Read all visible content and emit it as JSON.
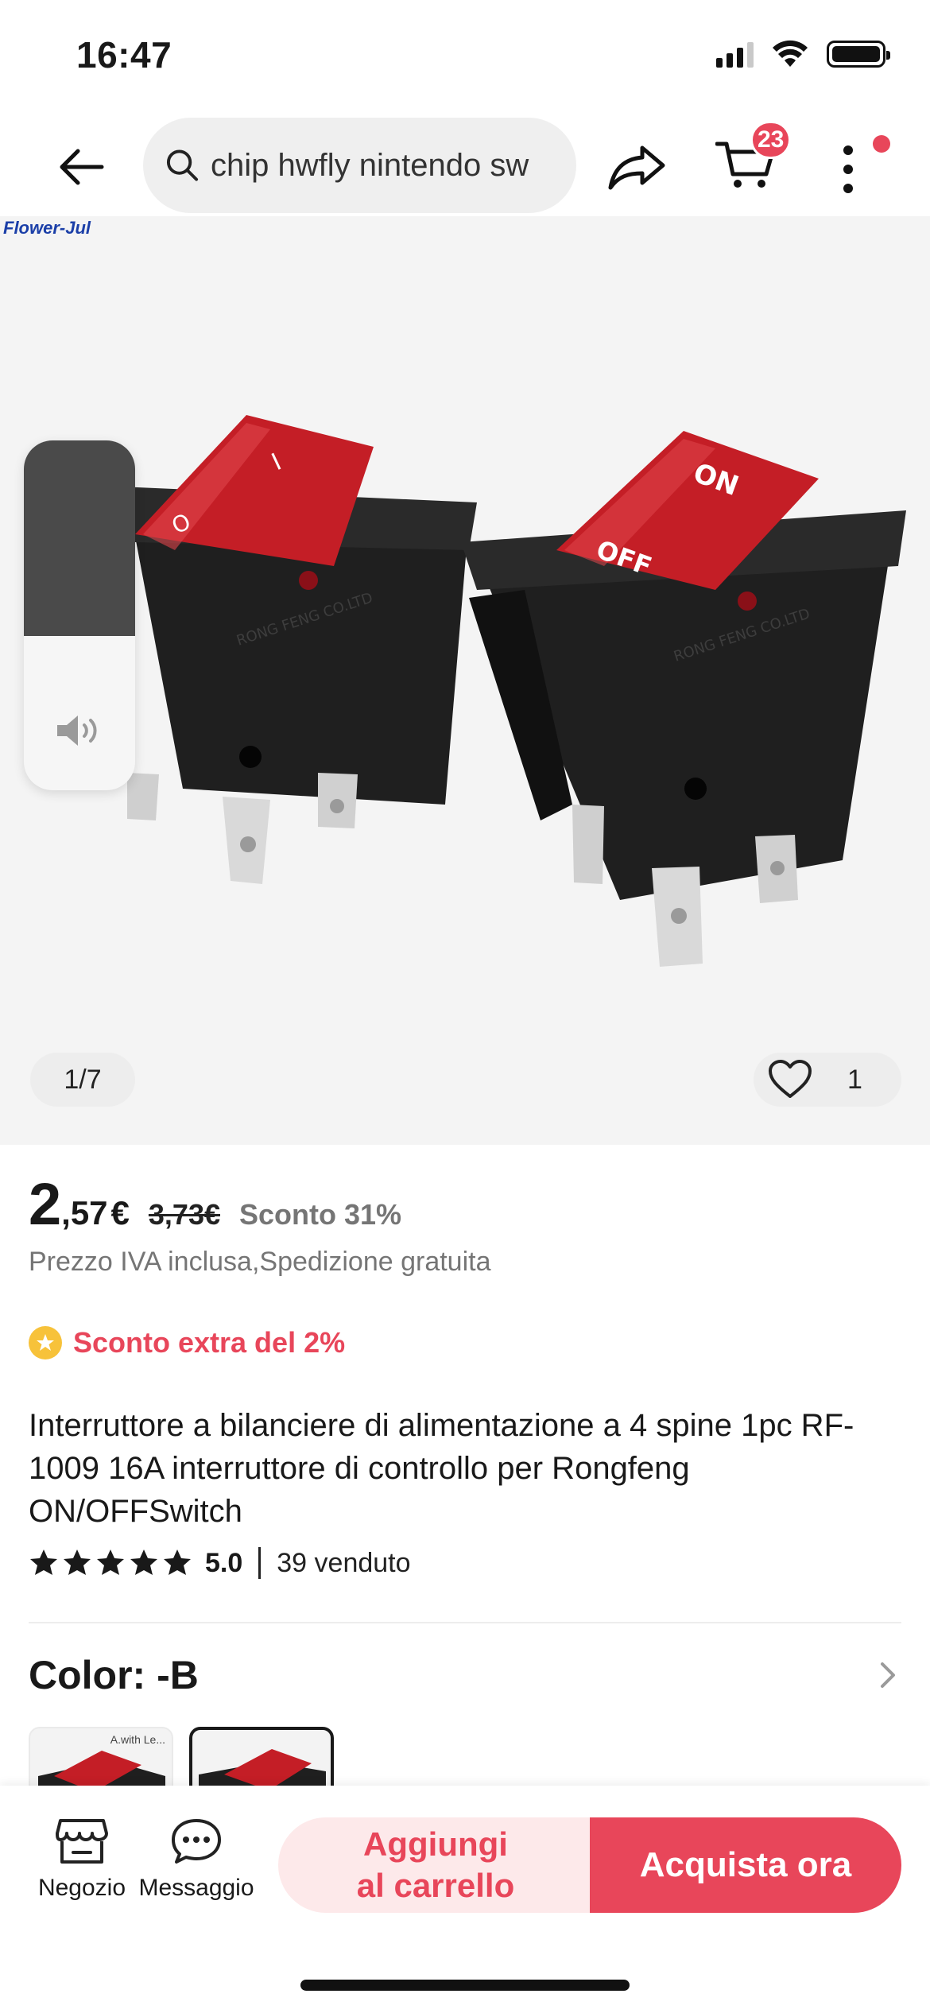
{
  "status_bar": {
    "time": "16:47"
  },
  "header": {
    "search_value": "chip hwfly nintendo sw",
    "cart_count": "23"
  },
  "gallery": {
    "watermark": "Flower-Jul",
    "page_indicator": "1/7",
    "wishlist_count": "1",
    "volume_level": 0.56,
    "switch_labels": {
      "on": "ON",
      "off": "OFF",
      "one": "I",
      "zero": "O"
    },
    "switch_body_text": "RONG FENG CO.LTD"
  },
  "price": {
    "integer": "2",
    "decimal": ",57",
    "currency": "€",
    "original": "3,73€",
    "discount": "Sconto 31%"
  },
  "tax_note": "Prezzo IVA inclusa,Spedizione gratuita",
  "extra_discount": "Sconto extra del 2%",
  "product": {
    "title": "Interruttore a bilanciere di alimentazione a 4 spine 1pc RF-1009 16A interruttore di controllo per Rongfeng ON/OFFSwitch",
    "rating": "5.0",
    "rating_stars": 5,
    "sold": "39 venduto"
  },
  "variants": {
    "label": "Color: -B",
    "swatch_caption": "A.with Le..."
  },
  "bottom_bar": {
    "store_label": "Negozio",
    "message_label": "Messaggio",
    "add_to_cart_line1": "Aggiungi",
    "add_to_cart_line2": "al carrello",
    "buy_now": "Acquista ora"
  },
  "colors": {
    "accent": "#e8465a",
    "accent_light": "#fde9ea",
    "switch_red": "#c41e26",
    "text_primary": "#191919",
    "text_secondary": "#757575",
    "gallery_bg": "#f4f4f4"
  }
}
